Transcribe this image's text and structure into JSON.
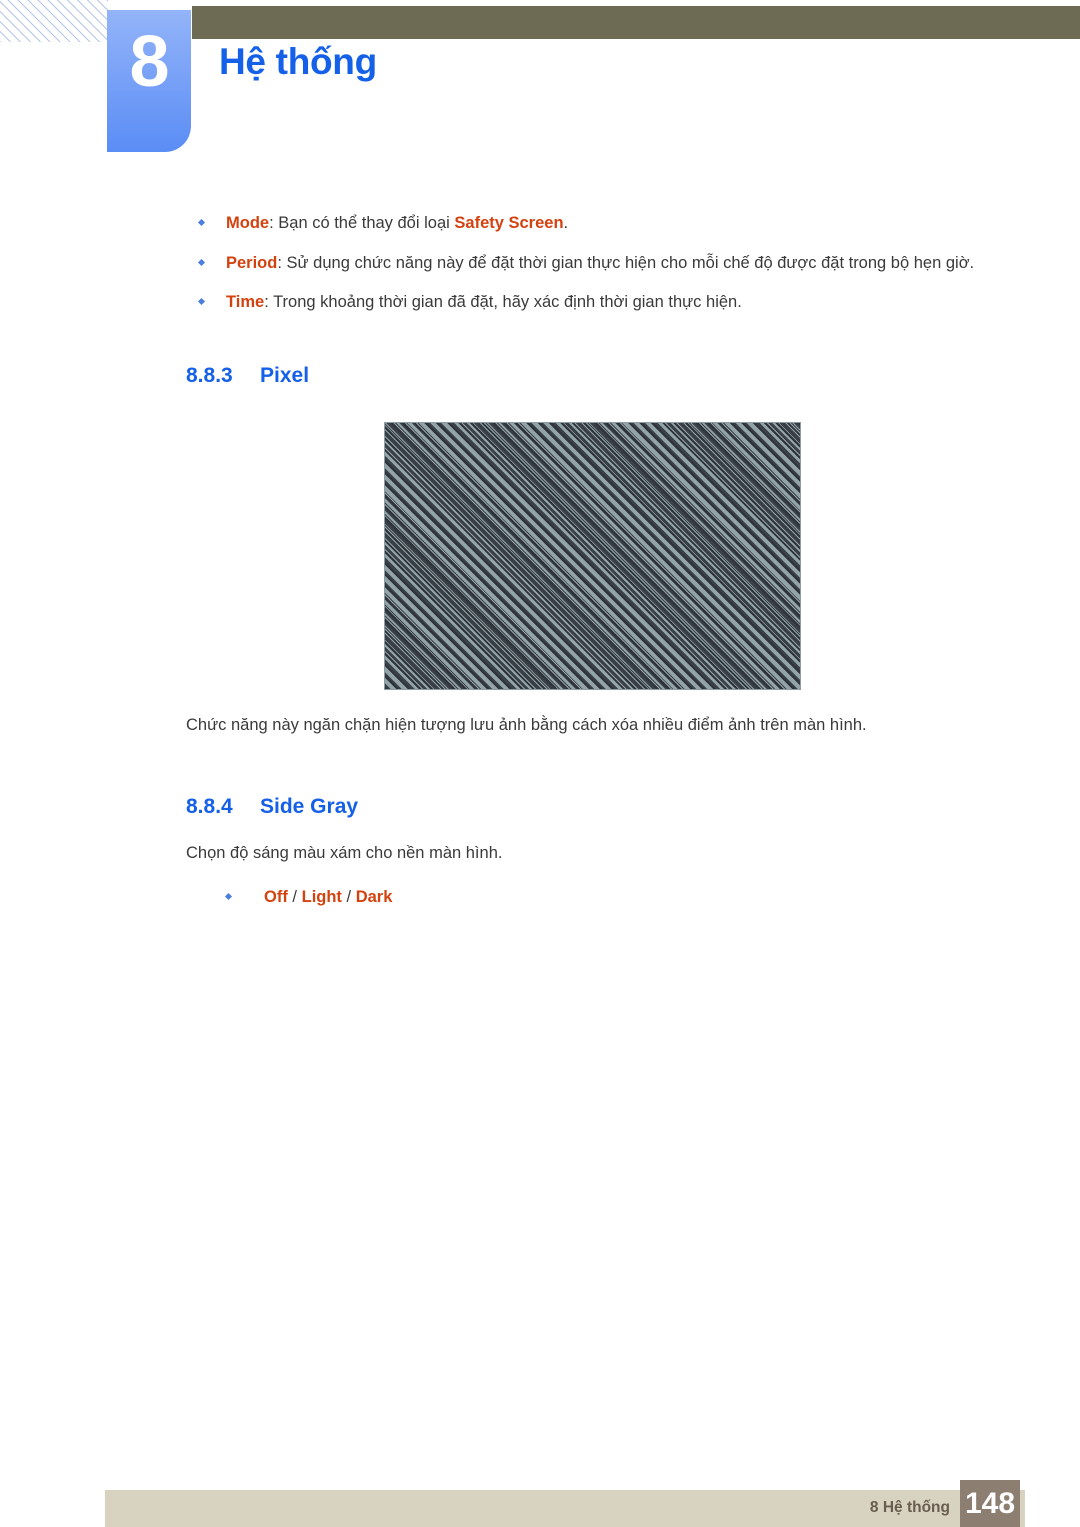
{
  "header": {
    "chapter_number": "8",
    "chapter_title": "Hệ thống",
    "bar_color": "#6e6b55",
    "tab_color": "#7aa2f7",
    "title_color": "#1560e8"
  },
  "intro_bullets": [
    {
      "term": "Mode",
      "text_before": ": Bạn có thể thay đổi loại ",
      "emphasis": "Safety Screen",
      "text_after": "."
    },
    {
      "term": "Period",
      "text_before": ": Sử dụng chức năng này để đặt thời gian thực hiện cho mỗi chế độ được đặt trong bộ hẹn giờ.",
      "emphasis": "",
      "text_after": ""
    },
    {
      "term": "Time",
      "text_before": ": Trong khoảng thời gian đã đặt, hãy xác định thời gian thực hiện.",
      "emphasis": "",
      "text_after": ""
    }
  ],
  "sections": [
    {
      "number": "8.8.3",
      "title": "Pixel",
      "figure": {
        "name": "pixel-pattern-illustration",
        "background_color": "#93a4a8",
        "stripe_color": "#2c3238",
        "description": "diagonal dotted stripe pattern"
      },
      "caption": "Chức năng này ngăn chặn hiện tượng lưu ảnh bằng cách xóa nhiều điểm ảnh trên màn hình."
    },
    {
      "number": "8.8.4",
      "title": "Side Gray",
      "body": "Chọn độ sáng màu xám cho nền màn hình.",
      "options": [
        "Off",
        "Light",
        "Dark"
      ],
      "option_separator": "/"
    }
  ],
  "footer": {
    "label": "8 Hệ thống",
    "page_number": "148",
    "bar_color": "#d8d2c0",
    "badge_color": "#8d7e72"
  }
}
